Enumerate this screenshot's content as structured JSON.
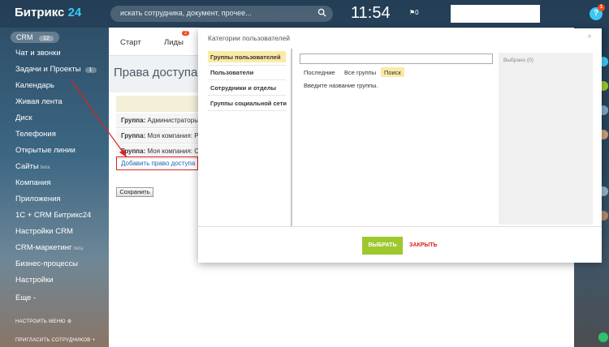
{
  "app": {
    "logo_text": "Битрикс",
    "logo_num": "24"
  },
  "search": {
    "placeholder": "искать сотрудника, документ, прочее..."
  },
  "clock": "11:54",
  "flag_count": "0",
  "help": {
    "label": "?",
    "badge": "1"
  },
  "sidebar": {
    "crm_label": "CRM",
    "crm_count": "12",
    "items": [
      {
        "label": "Чат и звонки"
      },
      {
        "label": "Задачи и Проекты",
        "count": "1"
      },
      {
        "label": "Календарь"
      },
      {
        "label": "Живая лента"
      },
      {
        "label": "Диск"
      },
      {
        "label": "Телефония"
      },
      {
        "label": "Открытые линии"
      },
      {
        "label": "Сайты",
        "beta": "beta"
      },
      {
        "label": "Компания"
      },
      {
        "label": "Приложения"
      },
      {
        "label": "1С + CRM Битрикс24"
      },
      {
        "label": "Настройки CRM"
      },
      {
        "label": "CRM-маркетинг",
        "beta": "beta"
      },
      {
        "label": "Бизнес-процессы"
      },
      {
        "label": "Настройки"
      },
      {
        "label": "Еще -"
      }
    ],
    "configure_menu": "НАСТРОИТЬ МЕНЮ",
    "invite": "ПРИГЛАСИТЬ СОТРУДНИКОВ"
  },
  "tabs": {
    "start": "Старт",
    "leads": "Лиды",
    "leads_badge": "2"
  },
  "page": {
    "title": "Права доступа к",
    "groups": [
      {
        "prefix": "Группа:",
        "value": "Администраторы"
      },
      {
        "prefix": "Группа:",
        "value": "Моя компания: Руководство"
      },
      {
        "prefix": "Группа:",
        "value": "Моя компания: Сотрудники"
      }
    ],
    "add_link": "Добавить право доступа",
    "save": "Сохранить"
  },
  "dialog": {
    "title": "Категории пользователей",
    "close": "×",
    "nav": [
      "Группы пользователей",
      "Пользователи",
      "Сотрудники и отделы",
      "Группы социальной сети"
    ],
    "subtabs": [
      "Последние",
      "Все группы",
      "Поиск"
    ],
    "hint": "Введите название группы.",
    "selected": "Выбрано (0)",
    "pick": "ВЫБРАТЬ",
    "cancel": "ЗАКРЫТЬ"
  },
  "colors": {
    "accent": "#3bc8f5",
    "pick_green": "#9dc82e",
    "highlight": "#fbe9a6",
    "alert_red": "#e02020"
  }
}
